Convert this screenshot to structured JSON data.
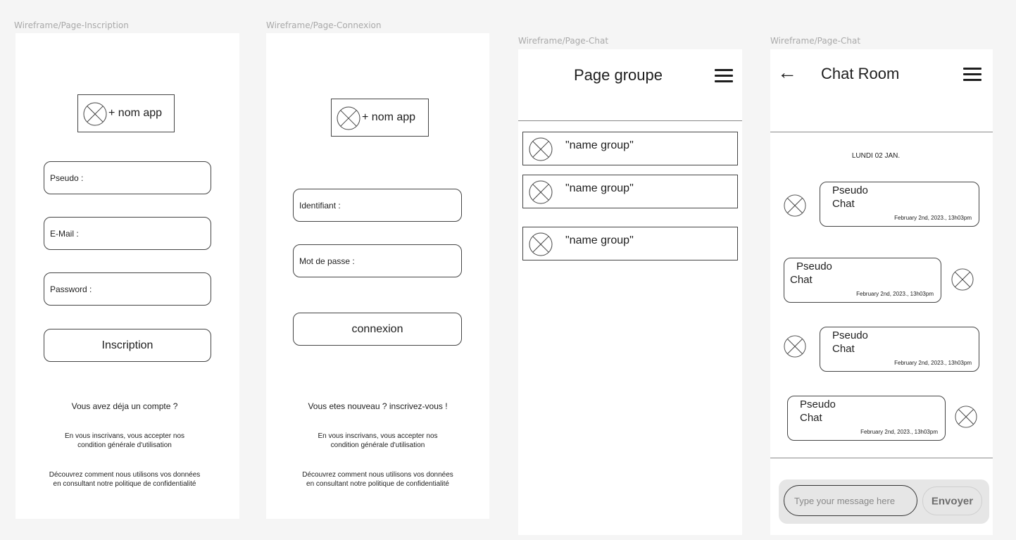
{
  "frames": {
    "inscription": {
      "label": "Wireframe/Page-Inscription",
      "logo_text": "+ nom app",
      "fields": [
        "Pseudo :",
        "E-Mail :",
        "Password :"
      ],
      "button": "Inscription",
      "account_text": "Vous avez déja un compte ?",
      "terms_line1": "En vous inscrivans, vous accepter nos",
      "terms_line2": "condition générale d'utilisation",
      "privacy_line1": "Découvrez comment nous utilisons vos données",
      "privacy_line2": "en consultant notre politique de confidentialité"
    },
    "connexion": {
      "label": "Wireframe/Page-Connexion",
      "logo_text": "+ nom app",
      "fields": [
        "Identifiant :",
        "Mot de passe :"
      ],
      "button": "connexion",
      "new_text": "Vous etes nouveau ? inscrivez-vous !",
      "terms_line1": "En vous inscrivans, vous accepter nos",
      "terms_line2": "condition générale d'utilisation",
      "privacy_line1": "Découvrez comment nous utilisons vos données",
      "privacy_line2": "en consultant notre politique de confidentialité"
    },
    "groups": {
      "label": "Wireframe/Page-Chat",
      "title": "Page groupe",
      "items": [
        "\"name group\"",
        "\"name group\"",
        "\"name group\""
      ]
    },
    "chatroom": {
      "label": "Wireframe/Page-Chat",
      "back_glyph": "←",
      "title": "Chat Room",
      "date": "LUNDI 02 JAN.",
      "messages": [
        {
          "pseudo": "Pseudo",
          "text": "Chat",
          "time": "February 2nd, 2023., 13h03pm",
          "side": "left"
        },
        {
          "pseudo": "Pseudo",
          "text": "Chat",
          "time": "February 2nd, 2023., 13h03pm",
          "side": "right"
        },
        {
          "pseudo": "Pseudo",
          "text": "Chat",
          "time": "February 2nd, 2023., 13h03pm",
          "side": "left"
        },
        {
          "pseudo": "Pseudo",
          "text": "Chat",
          "time": "February 2nd, 2023., 13h03pm",
          "side": "right"
        }
      ],
      "input_placeholder": "Type your message here",
      "send_label": "Envoyer"
    }
  },
  "icons": {
    "placeholder": "image-placeholder-icon",
    "menu": "menu-icon",
    "back": "back-arrow-icon"
  }
}
